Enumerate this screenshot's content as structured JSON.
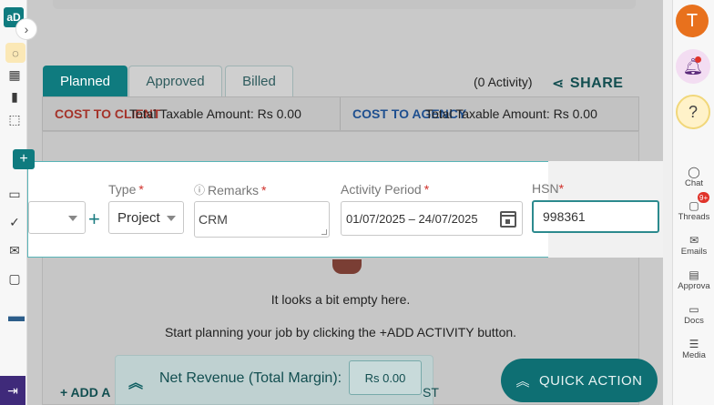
{
  "left_rail": {
    "logo": "aD",
    "expand_icon": "›",
    "plus": "+",
    "items": [
      "home-icon",
      "grid-icon",
      "chart-icon",
      "box-icon",
      "folder-icon",
      "check-circle-icon",
      "inbox-icon",
      "chat-icon",
      "drive-icon",
      "logout-icon"
    ]
  },
  "tabs": [
    {
      "label": "Planned"
    },
    {
      "label": "Approved"
    },
    {
      "label": "Billed"
    }
  ],
  "activity_count": "(0 Activity)",
  "share_label": "SHARE",
  "cost": {
    "client_label": "COST TO CLIENT",
    "client_amount": "Total Taxable Amount: Rs 0.00",
    "agency_label": "COST TO AGENCY",
    "agency_amount": "Total Taxable Amount: Rs 0.00"
  },
  "empty": {
    "title": "It looks a bit empty here.",
    "subtitle": "Start planning your job by clicking the +ADD ACTIVITY button."
  },
  "add_activity": "+ ADD A",
  "net_revenue": {
    "label": "Net Revenue (Total Margin):",
    "value": "Rs 0.00",
    "tail": "ST"
  },
  "quick_action": "QUICK ACTION",
  "form": {
    "type_label": "Type",
    "type_value": "Project",
    "remarks_label": "Remarks",
    "remarks_value": "CRM",
    "activity_period_label": "Activity Period",
    "activity_period_value": "01/07/2025 – 24/07/2025",
    "hsn_label": "HSN",
    "hsn_value": "998361",
    "required_mark": "*"
  },
  "right_rail": {
    "avatar_initial": "T",
    "threads_badge": "9+",
    "nav": [
      "Chat",
      "Threads",
      "Emails",
      "Approva",
      "Docs",
      "Media"
    ]
  },
  "colors": {
    "teal": "#0f7b7f",
    "client_red": "#a4332a",
    "agency_blue": "#1e4f8f",
    "avatar_orange": "#e8711d"
  }
}
